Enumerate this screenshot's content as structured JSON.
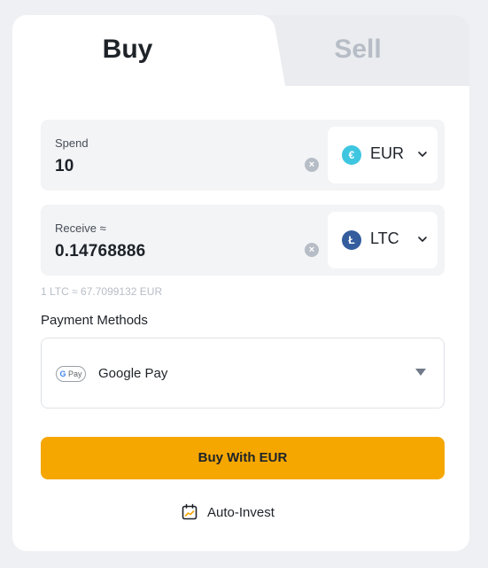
{
  "tabs": {
    "buy": "Buy",
    "sell": "Sell",
    "active": "Buy"
  },
  "spend": {
    "label": "Spend",
    "value": "10",
    "currency": "EUR",
    "currency_icon": "euro-coin-icon",
    "currency_symbol": "€"
  },
  "receive": {
    "label": "Receive ≈",
    "value": "0.14768886",
    "currency": "LTC",
    "currency_icon": "litecoin-icon",
    "currency_symbol": "Ł"
  },
  "rate": "1 LTC ≈ 67.7099132 EUR",
  "payment": {
    "title": "Payment Methods",
    "method": "Google Pay",
    "method_icon_text": "Pay"
  },
  "buy_button": "Buy With EUR",
  "auto_invest": "Auto-Invest",
  "colors": {
    "accent": "#f5a700",
    "eur_icon": "#3ec6e0",
    "ltc_icon": "#345d9d",
    "muted": "#b7bdc6"
  }
}
